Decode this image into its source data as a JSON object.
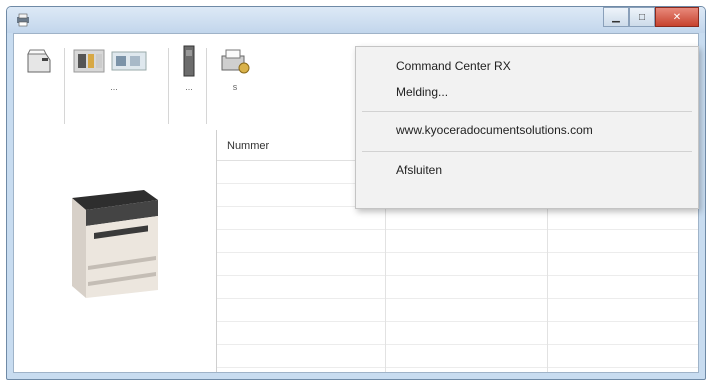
{
  "window": {
    "controls": {
      "minimize_icon": "minimize-icon",
      "maximize_icon": "maximize-icon",
      "close_icon": "close-icon"
    }
  },
  "toolbar": {
    "items": [
      {
        "icon": "printer-tray-icon",
        "label": ""
      },
      {
        "icon": "color-bars-icon",
        "label": "..."
      },
      {
        "icon": "toner-cartridge-icon",
        "label": "..."
      },
      {
        "icon": "settings-printer-icon",
        "label": "s"
      }
    ]
  },
  "grid": {
    "column_header": "Nummer"
  },
  "menu": {
    "items": [
      "Command Center RX",
      "Melding...",
      "www.kyoceradocumentsolutions.com",
      "Afsluiten"
    ]
  },
  "colors": {
    "title_bar": "#c8dcf0",
    "close_button": "#c7422e",
    "menu_bg": "#f2f2f2"
  }
}
